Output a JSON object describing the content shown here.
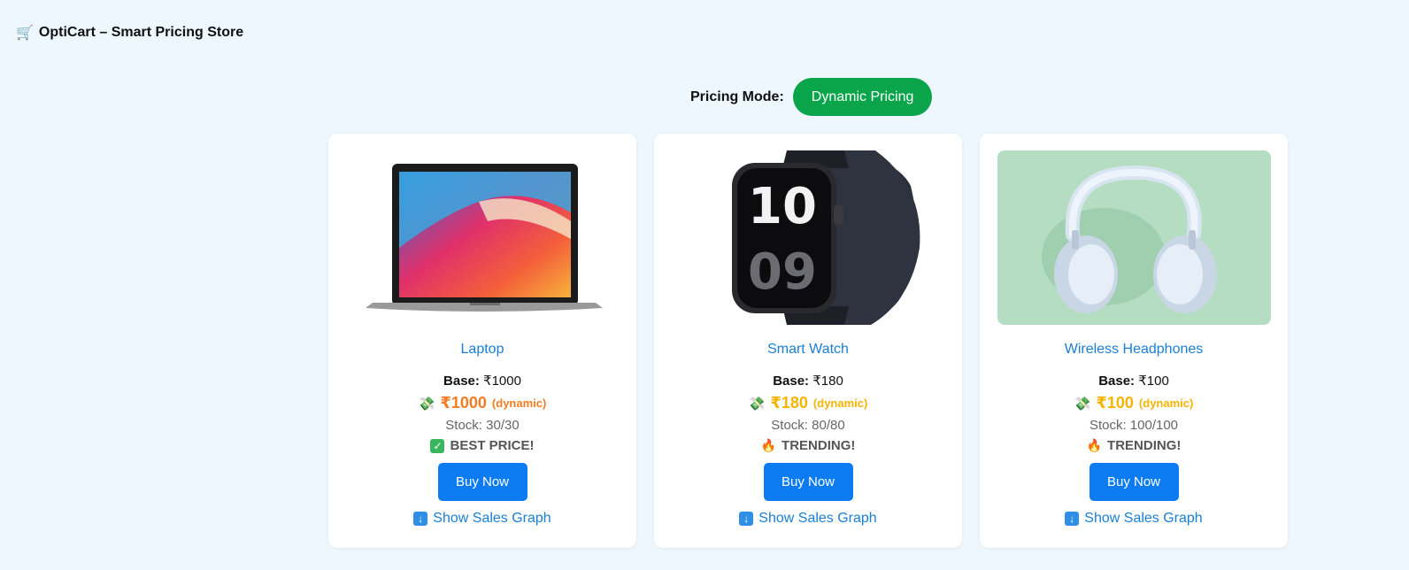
{
  "header": {
    "brand_icon": "cart-icon",
    "brand_title": "OptiCart – Smart Pricing Store"
  },
  "pricing_mode": {
    "label": "Pricing Mode:",
    "button_label": "Dynamic Pricing",
    "button_color": "#0aa54a"
  },
  "colors": {
    "accent": "#0d7cf2",
    "link": "#1a7fd4",
    "price_orange": "#f57c20",
    "price_amber": "#f5b400",
    "background": "#eef6fe"
  },
  "products": [
    {
      "name": "Laptop",
      "base_label": "Base:",
      "base_price": "₹1000",
      "price_icon": "money-icon",
      "price": "₹1000",
      "price_tag": "(dynamic)",
      "price_color": "#f57c20",
      "stock": "Stock: 30/30",
      "badge_icon": "check-icon",
      "badge": "BEST PRICE!",
      "buy_label": "Buy Now",
      "graph_icon": "arrow-down-icon",
      "graph_label": "Show Sales Graph"
    },
    {
      "name": "Smart Watch",
      "base_label": "Base:",
      "base_price": "₹180",
      "price_icon": "money-icon",
      "price": "₹180",
      "price_tag": "(dynamic)",
      "price_color": "#f5b400",
      "stock": "Stock: 80/80",
      "badge_icon": "fire-icon",
      "badge": "TRENDING!",
      "buy_label": "Buy Now",
      "graph_icon": "arrow-down-icon",
      "graph_label": "Show Sales Graph"
    },
    {
      "name": "Wireless Headphones",
      "base_label": "Base:",
      "base_price": "₹100",
      "price_icon": "money-icon",
      "price": "₹100",
      "price_tag": "(dynamic)",
      "price_color": "#f5b400",
      "stock": "Stock: 100/100",
      "badge_icon": "fire-icon",
      "badge": "TRENDING!",
      "buy_label": "Buy Now",
      "graph_icon": "arrow-down-icon",
      "graph_label": "Show Sales Graph"
    }
  ]
}
